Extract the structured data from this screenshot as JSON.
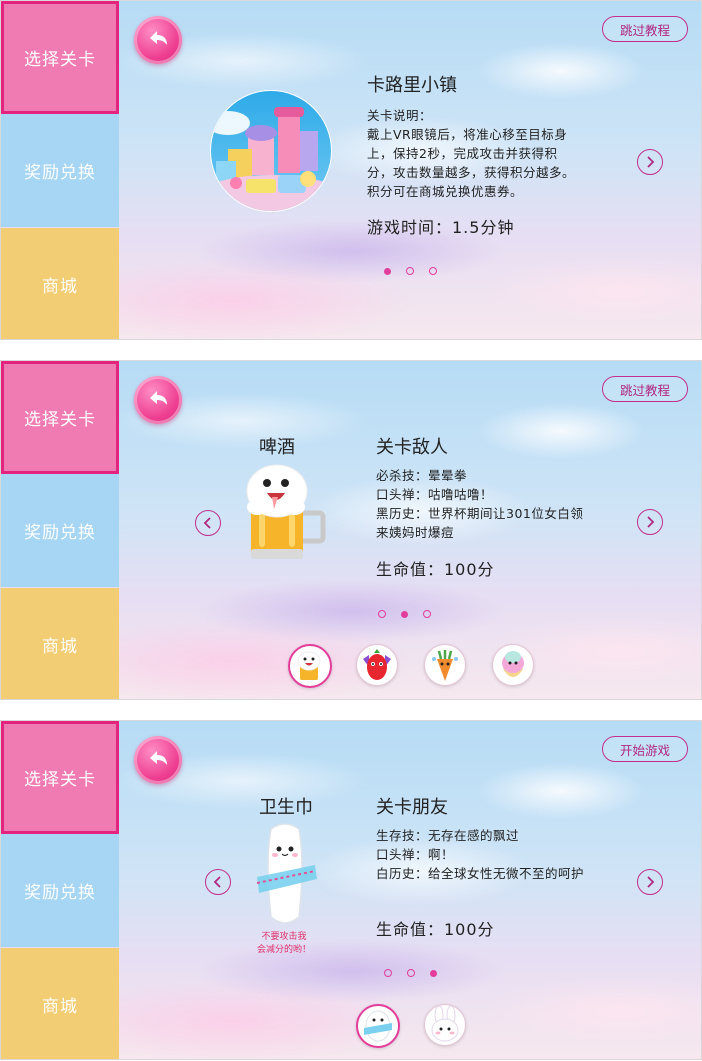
{
  "sidebar": {
    "items": [
      {
        "label": "选择关卡"
      },
      {
        "label": "奖励兑换"
      },
      {
        "label": "商城"
      }
    ]
  },
  "screens": [
    {
      "top_button": "跳过教程",
      "title": "卡路里小镇",
      "desc_lines": [
        "关卡说明：",
        "戴上VR眼镜后，将准心移至目标身",
        "上，保持2秒，完成攻击并获得积",
        "分，攻击数量越多，获得积分越多。",
        "积分可在商城兑换优惠券。"
      ],
      "stat": "游戏时间：1.5分钟",
      "page_index": 0,
      "page_count": 3
    },
    {
      "top_button": "跳过教程",
      "char_name": "啤酒",
      "title": "关卡敌人",
      "desc_lines": [
        "必杀技：晕晕拳",
        "口头禅：咕噜咕噜！",
        "黑历史：世界杯期间让301位女白领",
        "来姨妈时爆痘"
      ],
      "stat": "生命值：100分",
      "page_index": 1,
      "page_count": 3,
      "thumbnails": [
        "beer-thumb",
        "chili-thumb",
        "carrot-thumb",
        "sundae-thumb"
      ],
      "thumb_active": 0
    },
    {
      "top_button": "开始游戏",
      "char_name": "卫生巾",
      "title": "关卡朋友",
      "desc_lines": [
        "生存技：无存在感的飘过",
        "口头禅：啊！",
        "白历史：给全球女性无微不至的呵护"
      ],
      "warning_lines": [
        "不要攻击我",
        "会减分的哟！"
      ],
      "stat": "生命值：100分",
      "page_index": 2,
      "page_count": 3,
      "thumbnails": [
        "pad-thumb",
        "bunny-thumb"
      ],
      "thumb_active": 0
    }
  ],
  "colors": {
    "accent": "#e23d9a",
    "sidebar_active": "#ef7bb2",
    "sidebar_blue": "#a6d6f4",
    "sidebar_yellow": "#f2cd73"
  }
}
